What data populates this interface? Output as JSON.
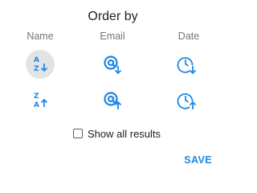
{
  "dialog": {
    "title": "Order by",
    "columns": {
      "name": "Name",
      "email": "Email",
      "date": "Date"
    },
    "sort_buttons": {
      "name_ascending": {
        "icon": "sort-alpha-ascending-icon",
        "letters_top": "A",
        "letters_bottom": "Z",
        "selected": true
      },
      "name_descending": {
        "icon": "sort-alpha-descending-icon",
        "letters_top": "Z",
        "letters_bottom": "A",
        "selected": false
      },
      "email_ascending": {
        "icon": "email-sort-down-icon",
        "selected": false
      },
      "email_descending": {
        "icon": "email-sort-up-icon",
        "selected": false
      },
      "date_ascending": {
        "icon": "clock-sort-down-icon",
        "selected": false
      },
      "date_descending": {
        "icon": "clock-sort-up-icon",
        "selected": false
      }
    },
    "show_all": {
      "label": "Show all results",
      "checked": false
    },
    "save_label": "SAVE",
    "accent_color": "#1e88e5"
  }
}
